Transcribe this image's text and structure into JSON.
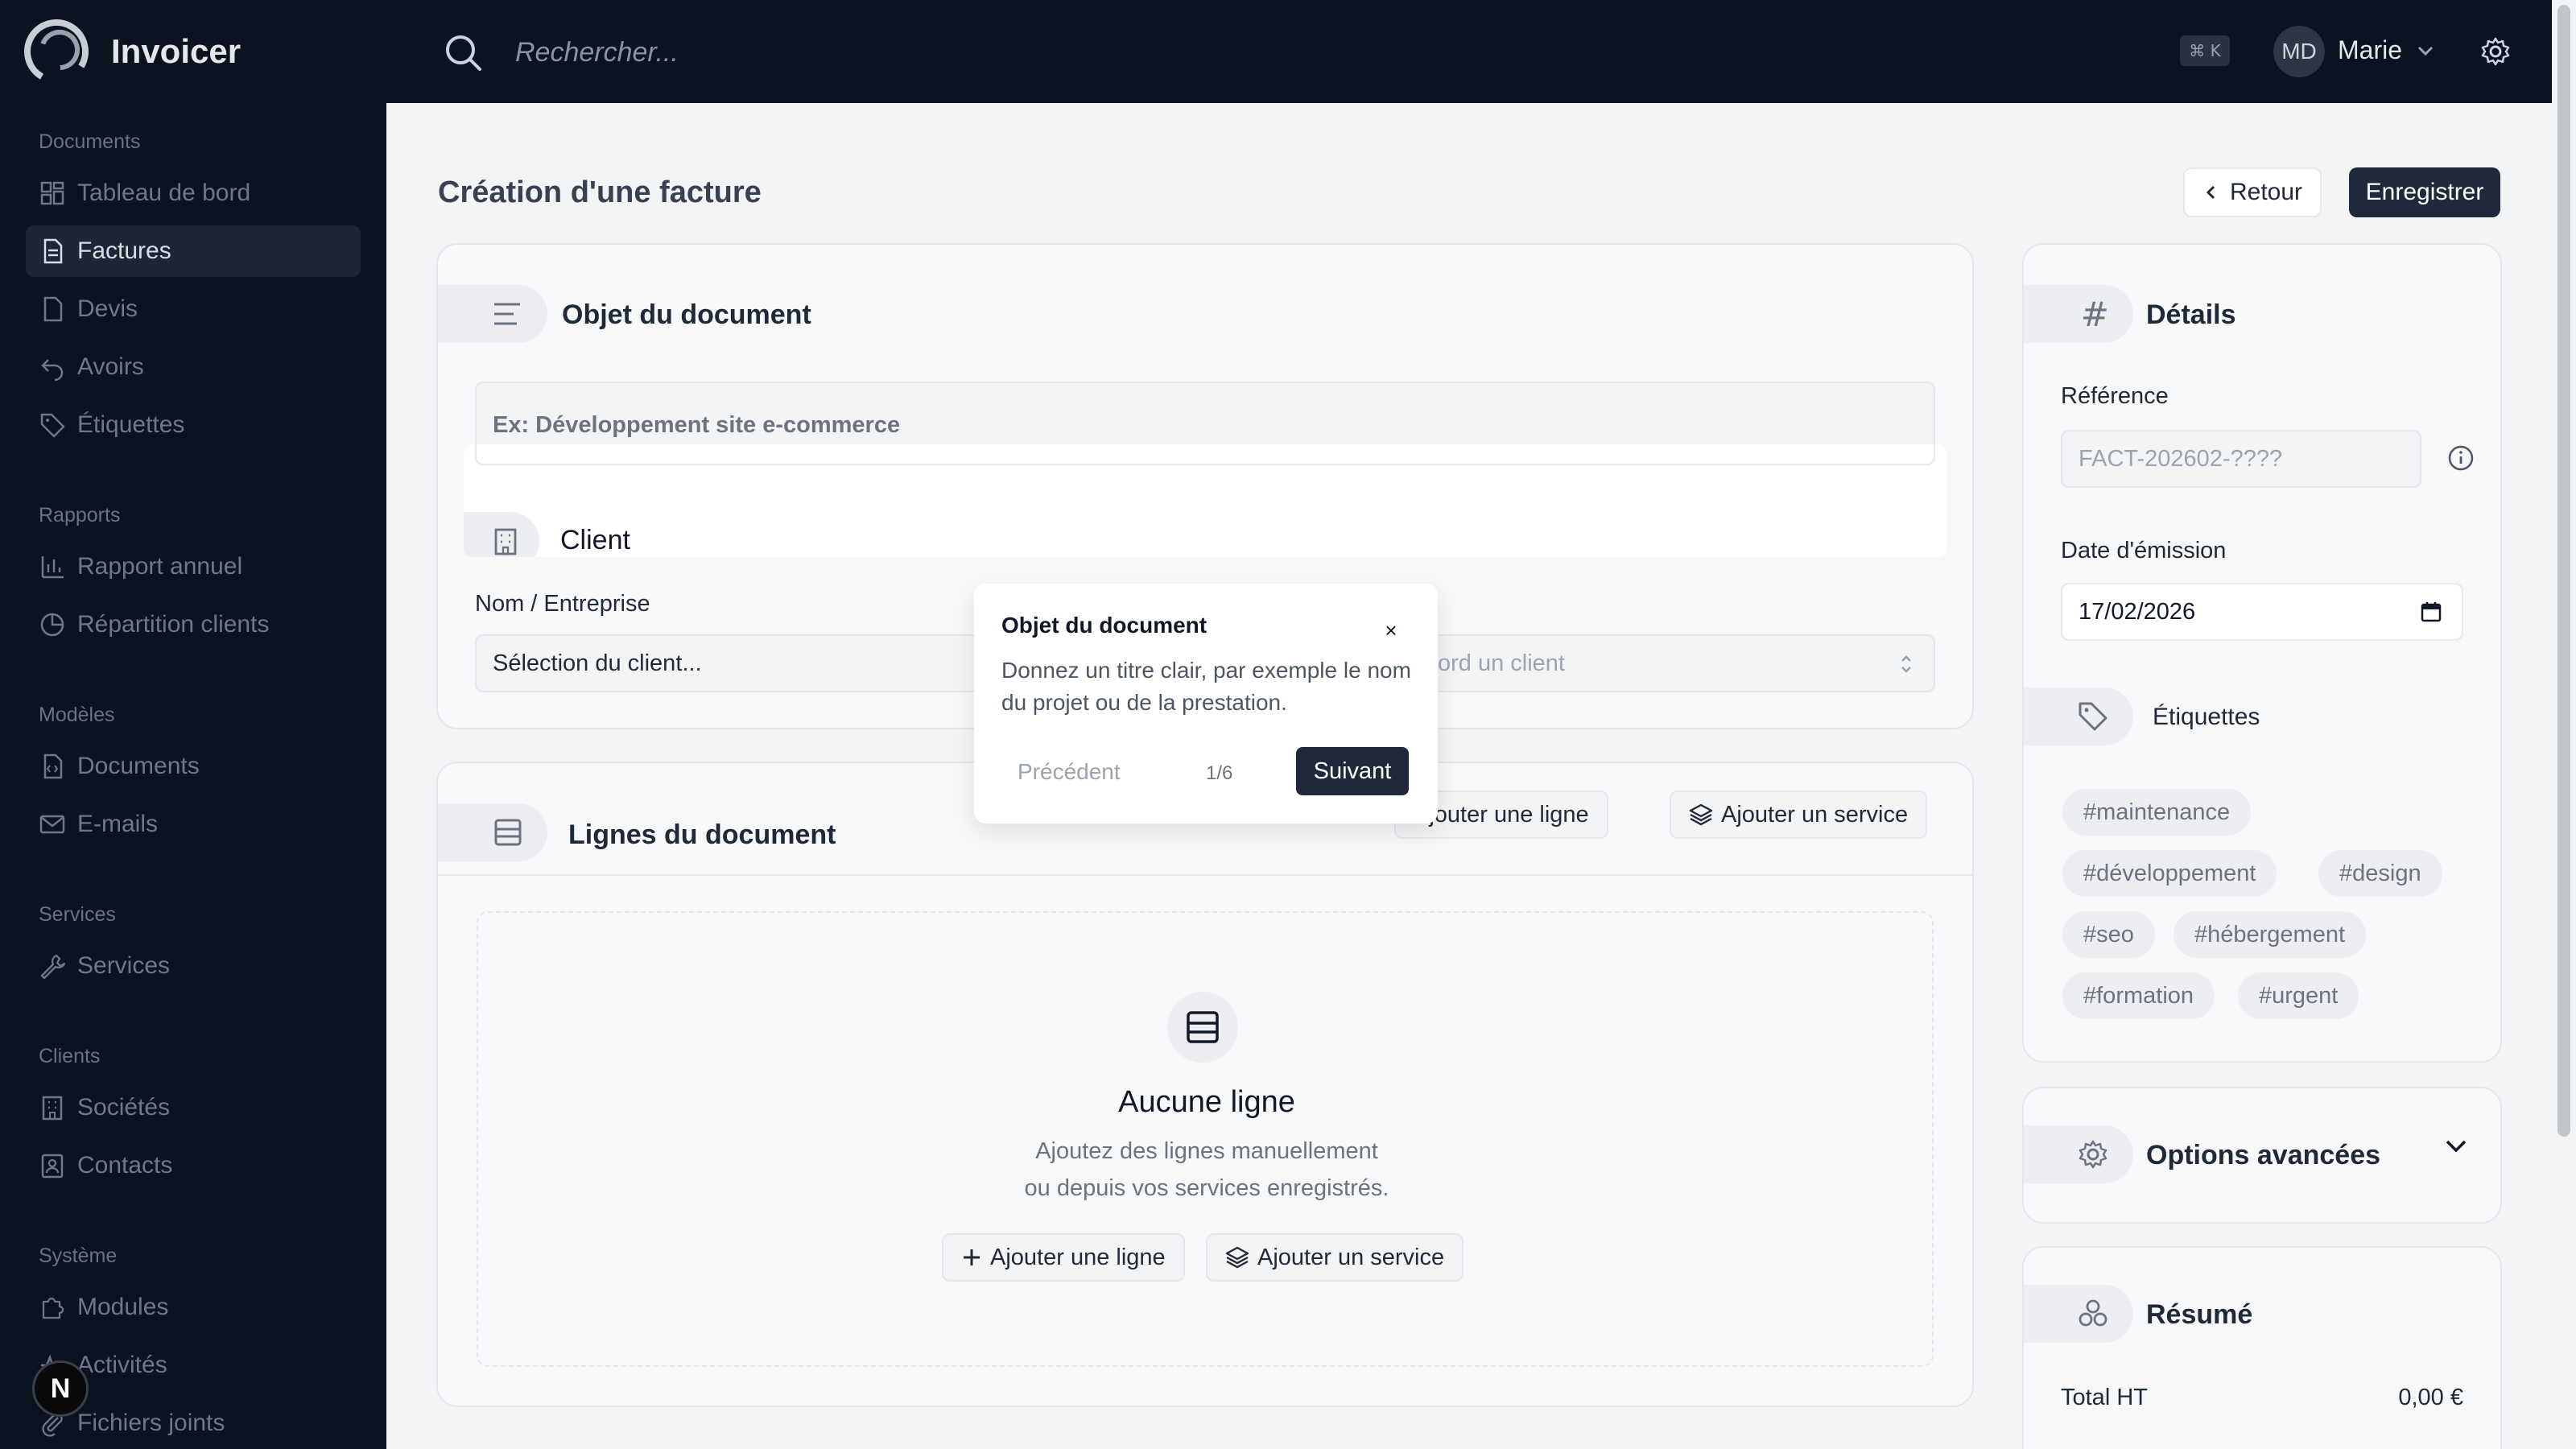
{
  "app": {
    "name": "Invoicer"
  },
  "search": {
    "placeholder": "Rechercher...",
    "shortcut": "⌘ K"
  },
  "user": {
    "initials": "MD",
    "name": "Marie"
  },
  "sidebar": {
    "sections": [
      {
        "title": "Documents",
        "items": [
          {
            "label": "Tableau de bord",
            "icon": "dashboard-icon"
          },
          {
            "label": "Factures",
            "icon": "file-text-icon",
            "active": true
          },
          {
            "label": "Devis",
            "icon": "file-icon"
          },
          {
            "label": "Avoirs",
            "icon": "undo-icon"
          },
          {
            "label": "Étiquettes",
            "icon": "tag-icon"
          }
        ]
      },
      {
        "title": "Rapports",
        "items": [
          {
            "label": "Rapport annuel",
            "icon": "bar-chart-icon"
          },
          {
            "label": "Répartition clients",
            "icon": "pie-chart-icon"
          }
        ]
      },
      {
        "title": "Modèles",
        "items": [
          {
            "label": "Documents",
            "icon": "file-code-icon"
          },
          {
            "label": "E-mails",
            "icon": "mail-icon"
          }
        ]
      },
      {
        "title": "Services",
        "items": [
          {
            "label": "Services",
            "icon": "wrench-icon"
          }
        ]
      },
      {
        "title": "Clients",
        "items": [
          {
            "label": "Sociétés",
            "icon": "building-icon"
          },
          {
            "label": "Contacts",
            "icon": "contact-icon"
          }
        ]
      },
      {
        "title": "Système",
        "items": [
          {
            "label": "Modules",
            "icon": "puzzle-icon"
          },
          {
            "label": "Activités",
            "icon": "activity-icon"
          },
          {
            "label": "Fichiers joints",
            "icon": "paperclip-icon"
          }
        ]
      }
    ]
  },
  "page": {
    "title": "Création d'une facture",
    "back_label": "Retour",
    "save_label": "Enregistrer"
  },
  "object_card": {
    "title": "Objet du document",
    "placeholder": "Ex: Développement site e-commerce"
  },
  "client_card": {
    "title": "Client",
    "name_label": "Nom / Entreprise",
    "select_placeholder": "Sélection du client...",
    "secondary_placeholder": "ord un client"
  },
  "lines_card": {
    "title": "Lignes du document",
    "add_line": "Ajouter une ligne",
    "add_service": "Ajouter un service",
    "empty_title": "Aucune ligne",
    "empty_text_1": "Ajoutez des lignes manuellement",
    "empty_text_2": "ou depuis vos services enregistrés."
  },
  "details_card": {
    "title": "Détails",
    "reference_label": "Référence",
    "reference_placeholder": "FACT-202602-????",
    "date_label": "Date d'émission",
    "date_value": "17/02/2026",
    "tags_title": "Étiquettes",
    "tags": [
      "#maintenance",
      "#développement",
      "#design",
      "#seo",
      "#hébergement",
      "#formation",
      "#urgent"
    ]
  },
  "advanced_card": {
    "title": "Options avancées"
  },
  "summary_card": {
    "title": "Résumé",
    "total_ht_label": "Total HT",
    "total_ht_value": "0,00 €"
  },
  "tour": {
    "title": "Objet du document",
    "body": "Donnez un titre clair, par exemple le nom du projet ou de la prestation.",
    "prev_label": "Précédent",
    "step": "1/6",
    "next_label": "Suivant",
    "close": "×"
  },
  "fab": {
    "label": "N"
  }
}
